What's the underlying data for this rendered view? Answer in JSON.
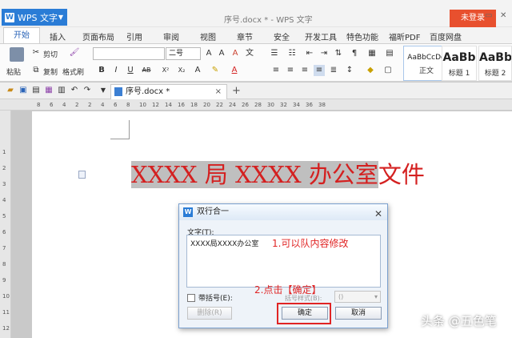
{
  "window": {
    "app_name": "WPS 文字",
    "document_title": "序号.docx * - WPS 文字",
    "login_button": "未登录"
  },
  "menu": {
    "tabs": [
      "开始",
      "插入",
      "页面布局",
      "引用",
      "审阅",
      "视图",
      "章节",
      "安全",
      "开发工具",
      "特色功能",
      "福昕PDF",
      "百度网盘"
    ]
  },
  "ribbon": {
    "paste": "粘贴",
    "cut": "剪切",
    "copy": "复制",
    "format_painter": "格式刷",
    "font_name": "",
    "font_size": "二号",
    "styles": [
      {
        "sample": "AaBbCcDd",
        "label": "正文"
      },
      {
        "sample": "AaBb",
        "label": "标题 1"
      },
      {
        "sample": "AaBb",
        "label": "标题 2"
      }
    ]
  },
  "doc_tab": {
    "name": "序号.docx *"
  },
  "ruler": {
    "h_ticks": [
      "8",
      "6",
      "4",
      "2",
      "2",
      "4",
      "6",
      "8",
      "10",
      "12",
      "14",
      "16",
      "18",
      "20",
      "22",
      "24",
      "26",
      "28",
      "30",
      "32",
      "34",
      "36",
      "38"
    ],
    "v_ticks": [
      "1",
      "2",
      "3",
      "4",
      "5",
      "6",
      "7",
      "8",
      "9",
      "10",
      "11",
      "12"
    ]
  },
  "document": {
    "heading_highlighted": "XXXX 局 XXXX 办公室",
    "heading_rest": "文件"
  },
  "dialog": {
    "title": "双行合一",
    "text_label": "文字(T):",
    "text_value": "XXXX局XXXX办公室",
    "bracket_label": "带括号(E):",
    "bracket_style_label": "括号样式(B):",
    "bracket_style_value": "()",
    "delete_button": "删除(R)",
    "ok_button": "确定",
    "cancel_button": "取消"
  },
  "annotations": {
    "step1": "1.可以队内容修改",
    "step2": "2.点击【确定】"
  },
  "watermark": "头条 @五色笔",
  "colors": {
    "accent_blue": "#2a7cd6",
    "login_red": "#e8502e",
    "heading_red": "#d42020",
    "annotation_red": "#e02424"
  }
}
